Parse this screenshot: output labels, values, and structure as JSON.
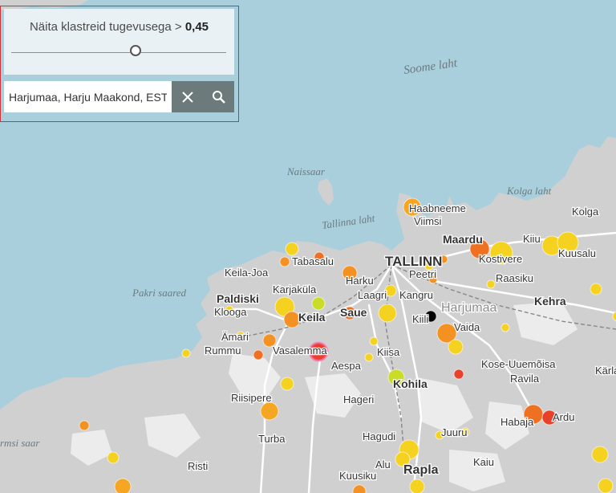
{
  "filter": {
    "label_prefix": "Näita klastreid tugevusega >",
    "threshold": "0,45",
    "slider_fraction": 0.58
  },
  "search": {
    "value": "Harjumaa, Harju Maakond, EST",
    "clear_icon": "close-icon",
    "search_icon": "search-icon"
  },
  "colors": {
    "water": "#a9cfdc",
    "land": "#d0d0d0",
    "forest": "#ececec",
    "road": "#ffffff",
    "cluster_strong": "#e8402a",
    "cluster_mid": "#f39222",
    "cluster_weak": "#f5d21f",
    "cluster_lime": "#c8dc28"
  },
  "map_labels": {
    "sea": [
      "Soome laht",
      "Naissaar",
      "Tallinna laht",
      "Kolga laht",
      "Pakri saared",
      "rmsi saar"
    ],
    "places": [
      "Haabneeme",
      "Viimsi",
      "Maardu",
      "Kostivere",
      "Kiiu",
      "Kolga",
      "Kuusalu",
      "TALLINN",
      "Tabasalu",
      "Keila-Joa",
      "Harku",
      "Peetri",
      "Raasiku",
      "Kehra",
      "Karjaküla",
      "Paldiski",
      "Klooga",
      "Laagri",
      "Kangru",
      "Saue",
      "Keila",
      "Kiili",
      "Harjumaa",
      "Vaida",
      "Ämari",
      "Rummu",
      "Vasalemma",
      "Aespa",
      "Kiisa",
      "Kose-Uuemõisa",
      "Ravila",
      "Kohila",
      "Kärla",
      "Riisipere",
      "Hageri",
      "Habaja",
      "Ardu",
      "Hagudi",
      "Juuru",
      "Turba",
      "Kaiu",
      "Alu",
      "Risti",
      "Kuusiku",
      "Rapla"
    ]
  }
}
